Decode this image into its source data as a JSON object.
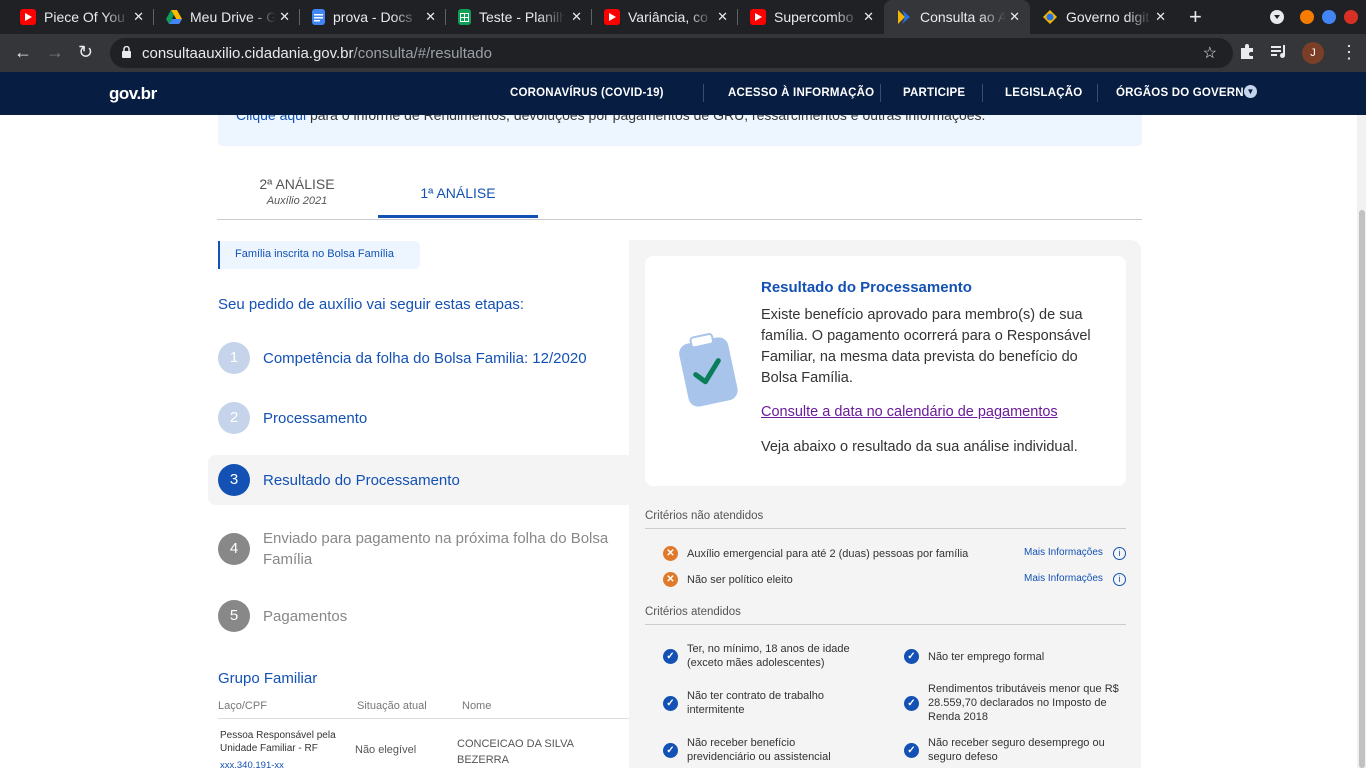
{
  "browser": {
    "tabs": [
      {
        "title": "Piece Of You",
        "icon": "youtube-icon",
        "color": "#ff0000"
      },
      {
        "title": "Meu Drive - G",
        "icon": "google-drive-icon",
        "color": "#1fa463"
      },
      {
        "title": "prova - Docs",
        "icon": "google-docs-icon",
        "color": "#4285f4"
      },
      {
        "title": "Teste - Planilh",
        "icon": "google-sheets-icon",
        "color": "#0f9d58"
      },
      {
        "title": "Variância, co",
        "icon": "youtube-icon",
        "color": "#ff0000"
      },
      {
        "title": "Supercombo",
        "icon": "youtube-icon",
        "color": "#ff0000"
      },
      {
        "title": "Consulta ao A",
        "icon": "caixa-icon",
        "color": "#f2b705",
        "active": true
      },
      {
        "title": "Governo digit",
        "icon": "gov-icon",
        "color": "#2670e8"
      }
    ],
    "url_host": "consultaauxilio.cidadania.gov.br",
    "url_path": "/consulta/#/resultado",
    "profile_initial": "J"
  },
  "govnav": {
    "logo": "gov.br",
    "links": [
      "CORONAVÍRUS (COVID-19)",
      "ACESSO À INFORMAÇÃO",
      "PARTICIPE",
      "LEGISLAÇÃO",
      "ÓRGÃOS DO GOVERNO"
    ]
  },
  "notice": {
    "link": "Clique aqui",
    "text": " para o informe de Rendimentos, devoluções por pagamentos de GRU, ressarcimentos e outras informações."
  },
  "analysis_tabs": [
    {
      "label": "2ª ANÁLISE",
      "sub": "Auxílio 2021"
    },
    {
      "label": "1ª ANÁLISE",
      "sub": ""
    }
  ],
  "badge": "Família inscrita no Bolsa Família",
  "steps_title": "Seu pedido de auxílio vai seguir estas etapas:",
  "steps": [
    {
      "n": "1",
      "label": "Competência da folha do Bolsa Familia: 12/2020"
    },
    {
      "n": "2",
      "label": "Processamento"
    },
    {
      "n": "3",
      "label": "Resultado do Processamento"
    },
    {
      "n": "4",
      "label": "Enviado para pagamento na próxima folha do Bolsa Família"
    },
    {
      "n": "5",
      "label": "Pagamentos"
    }
  ],
  "group": {
    "title": "Grupo Familiar",
    "headers": [
      "Laço/CPF",
      "Situação atual",
      "Nome"
    ],
    "row": {
      "role": "Pessoa Responsável pela Unidade Familiar - RF",
      "cpf": "xxx.340.191-xx",
      "status": "Não elegível",
      "name": "CONCEICAO DA SILVA BEZERRA"
    }
  },
  "result": {
    "title": "Resultado do Processamento",
    "body": "Existe benefício aprovado para membro(s) de sua família. O pagamento ocorrerá para o Responsável Familiar, na mesma data prevista do benefício do Bolsa Família.",
    "link": "Consulte a data no calendário de pagamentos",
    "footer": "Veja abaixo o resultado da sua análise individual."
  },
  "criteria_unmet": {
    "title": "Critérios não atendidos",
    "more_label": "Mais Informações",
    "items": [
      "Auxílio emergencial para até 2 (duas) pessoas por família",
      "Não ser político eleito"
    ]
  },
  "criteria_met": {
    "title": "Critérios atendidos",
    "items": [
      "Ter, no mínimo, 18 anos de idade (exceto mães adolescentes)",
      "Não ter emprego formal",
      "Não ter contrato de trabalho intermitente",
      "Rendimentos tributáveis menor que R$ 28.559,70 declarados no Imposto de Renda 2018",
      "Não receber benefício previdenciário ou assistencial",
      "Não receber seguro desemprego ou seguro defeso"
    ]
  }
}
